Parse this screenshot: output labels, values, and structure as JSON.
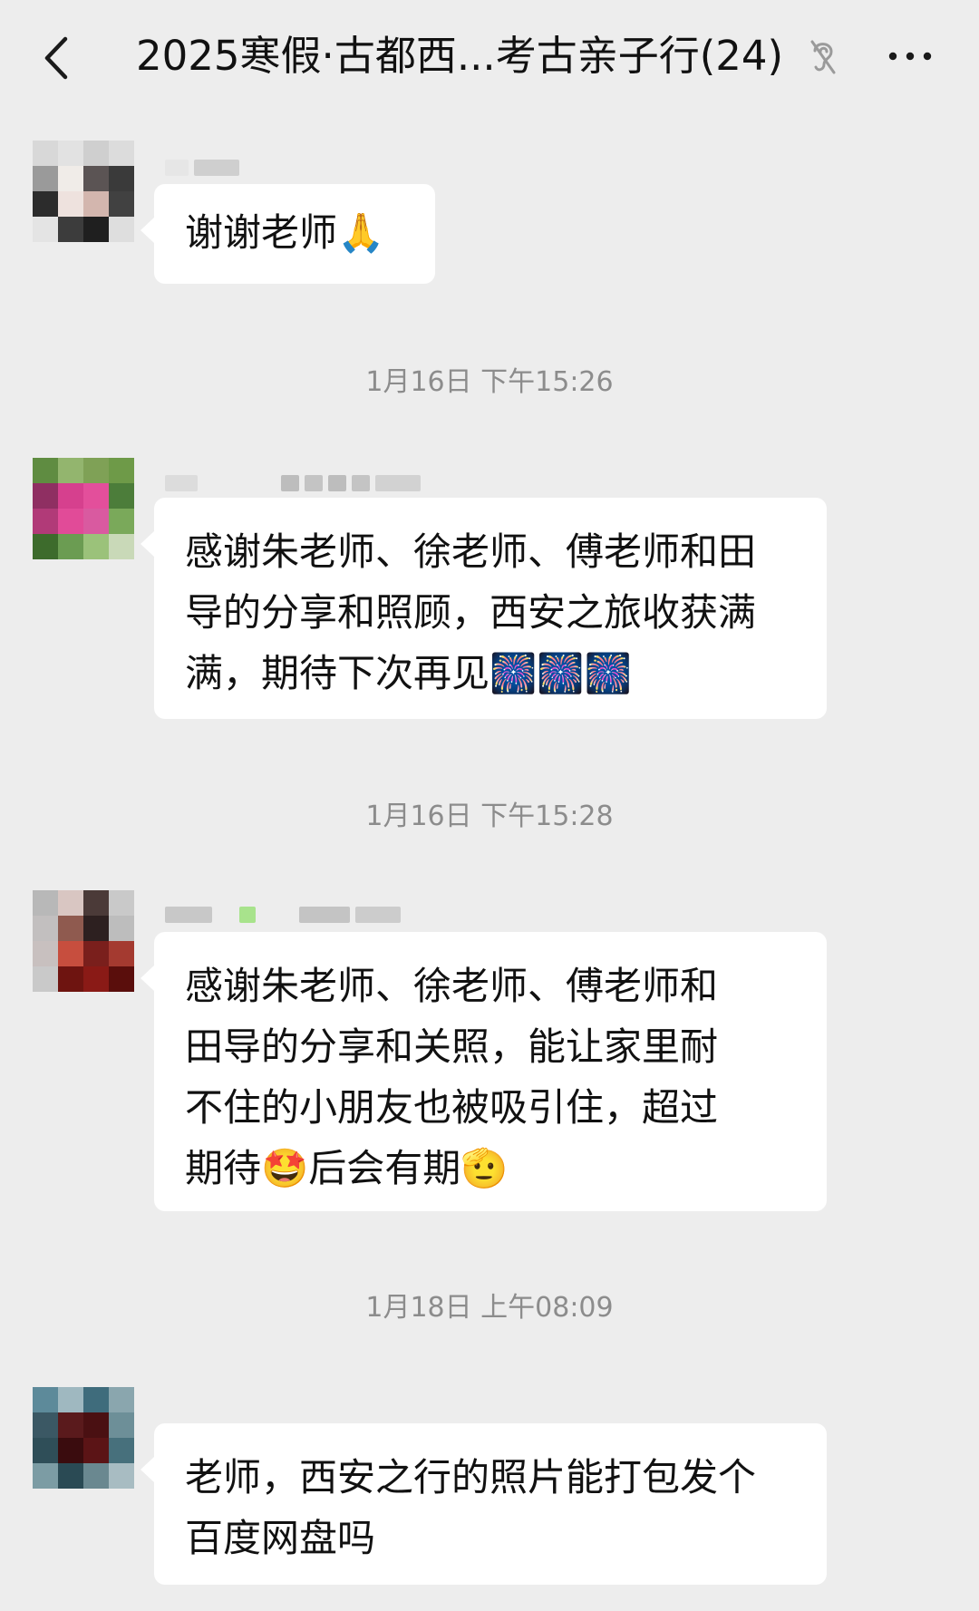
{
  "header": {
    "back_icon": "chevron-left-icon",
    "title": "2025寒假·古都西...考古亲子行(24)",
    "mute_icon": "ear-icon",
    "more_icon": "more-dots-icon"
  },
  "messages": [
    {
      "type": "message",
      "avatar_colors": [
        "#d8d8d8",
        "#e2e2e2",
        "#cfcfcf",
        "#dcdcdc",
        "#9a9a9a",
        "#f0ece8",
        "#5b5454",
        "#3a3a3a",
        "#2c2c2c",
        "#eee2de",
        "#d3b6ae",
        "#414141",
        "#e4e4e4",
        "#3c3c3c",
        "#1f1f1f",
        "#dedede"
      ],
      "text": "谢谢老师🙏"
    },
    {
      "type": "time",
      "text": "1月16日 下午15:26"
    },
    {
      "type": "message",
      "avatar_colors": [
        "#5f8c41",
        "#93b56e",
        "#7fa156",
        "#6e9a48",
        "#8f2f62",
        "#d6408e",
        "#e34f9b",
        "#4c7d3a",
        "#b13a78",
        "#e14b98",
        "#d95aa0",
        "#7aa95a",
        "#3d6b2c",
        "#6b9c52",
        "#9bc27a",
        "#c9d9b8"
      ],
      "text": "感谢朱老师、徐老师、傅老师和田\n导的分享和照顾，西安之旅收获满\n满，期待下次再见🎆🎆🎆"
    },
    {
      "type": "time",
      "text": "1月16日 下午15:28"
    },
    {
      "type": "message",
      "avatar_colors": [
        "#b8b8b8",
        "#d9c6c2",
        "#4b3a38",
        "#c9c9c9",
        "#c2bfbf",
        "#8f5a4f",
        "#2d2020",
        "#bdbdbd",
        "#c8c0bf",
        "#c74e3e",
        "#7a1f1c",
        "#a43a30",
        "#c9c9c9",
        "#6e1410",
        "#8a1a16",
        "#5a0e0c"
      ],
      "text": "感谢朱老师、徐老师、傅老师和\n田导的分享和关照，能让家里耐\n不住的小朋友也被吸引住，超过\n期待🤩后会有期🫡"
    },
    {
      "type": "time",
      "text": "1月18日 上午08:09"
    },
    {
      "type": "message",
      "avatar_colors": [
        "#5d8a9a",
        "#9fb8c0",
        "#3f6c7c",
        "#8aa6ae",
        "#3b5864",
        "#5a1a1c",
        "#4a1012",
        "#6d8f98",
        "#2f4e58",
        "#3a0c0e",
        "#5b1416",
        "#47707c",
        "#7c9ca4",
        "#2a4a54",
        "#6a8890",
        "#a8bcc2"
      ],
      "text": "老师，西安之行的照片能打包发个\n百度网盘吗"
    }
  ]
}
